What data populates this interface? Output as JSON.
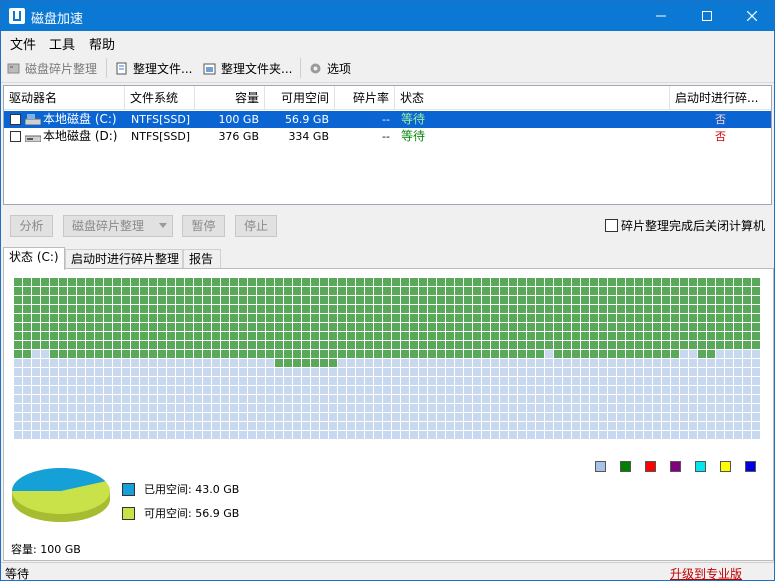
{
  "window": {
    "title": "磁盘加速"
  },
  "menu": {
    "items": [
      "文件",
      "工具",
      "帮助"
    ]
  },
  "toolbar": {
    "defrag": "磁盘碎片整理",
    "defrag_file": "整理文件...",
    "defrag_folder": "整理文件夹...",
    "options": "选项"
  },
  "table": {
    "headers": [
      "驱动器名",
      "文件系统",
      "容量",
      "可用空间",
      "碎片率",
      "状态",
      "启动时进行碎..."
    ],
    "rows": [
      {
        "name": "本地磁盘 (C:)",
        "fs": "NTFS[SSD]",
        "capacity": "100 GB",
        "free": "56.9 GB",
        "frag": "--",
        "status": "等待",
        "boot": "否",
        "selected": true
      },
      {
        "name": "本地磁盘 (D:)",
        "fs": "NTFS[SSD]",
        "capacity": "376 GB",
        "free": "334 GB",
        "frag": "--",
        "status": "等待",
        "boot": "否",
        "selected": false
      }
    ]
  },
  "actions": {
    "analyze": "分析",
    "defrag": "磁盘碎片整理",
    "pause": "暂停",
    "stop": "停止",
    "shutdown_label": "碎片整理完成后关闭计算机"
  },
  "tabs": [
    "状态 (C:)",
    "启动时进行碎片整理",
    "报告"
  ],
  "status_panel": {
    "used_label": "已用空间: 43.0 GB",
    "free_label": "可用空间: 56.9 GB",
    "capacity_label": "容量: 100 GB",
    "used_fraction": 0.43,
    "colors": {
      "used": "#16a0d8",
      "free": "#c9e24a",
      "map_used": "#5aa95a",
      "map_free": "#c8d8ef"
    },
    "legend_colors": [
      "#a9c3e8",
      "#008000",
      "#ff0000",
      "#800080",
      "#00e5ee",
      "#ffff00",
      "#0000e0"
    ]
  },
  "statusbar": {
    "status": "等待",
    "upgrade": "升级到专业版"
  }
}
